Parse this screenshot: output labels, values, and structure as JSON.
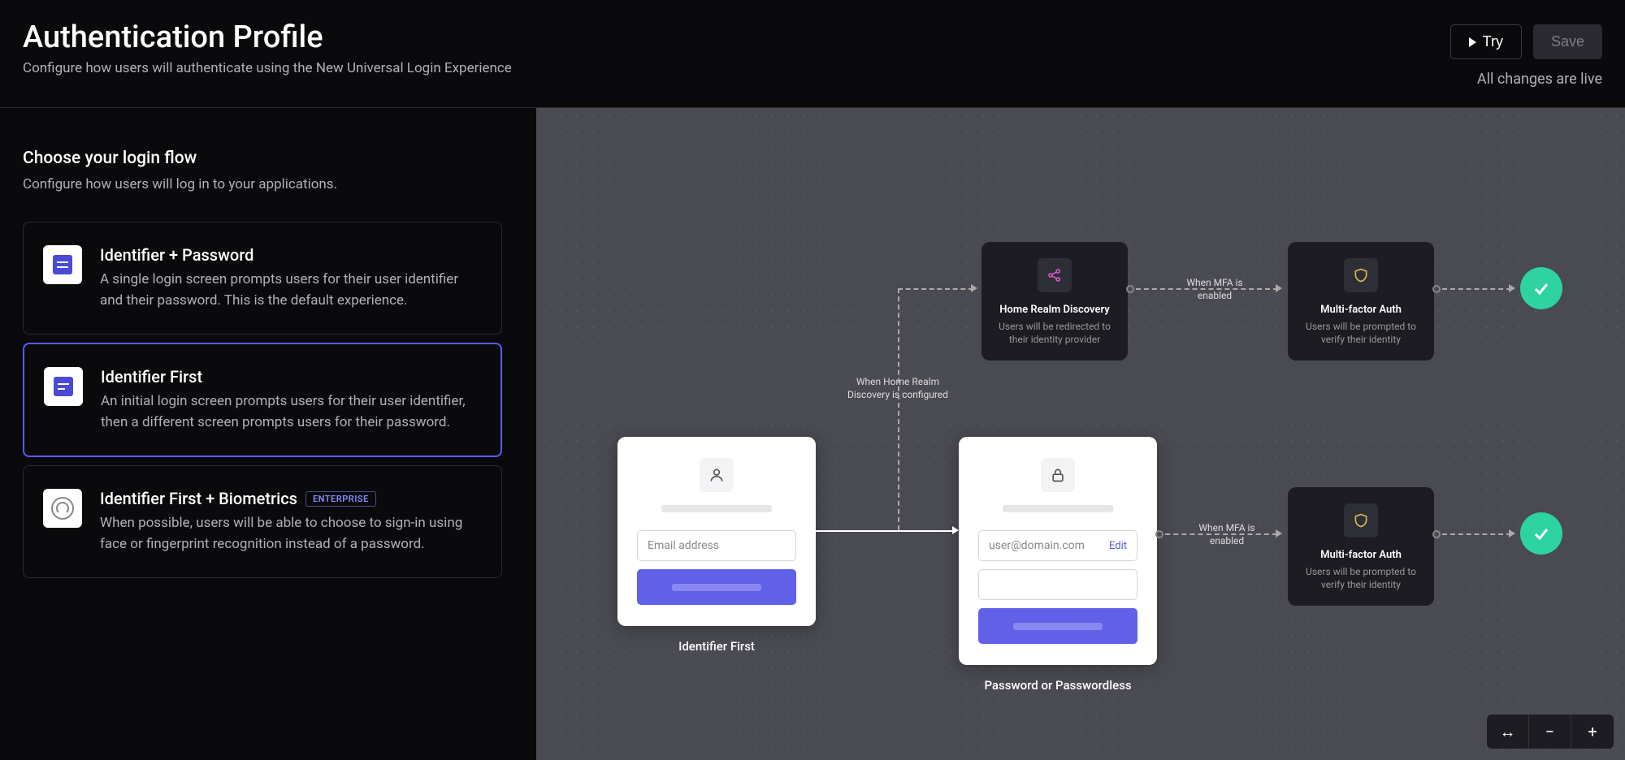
{
  "header": {
    "title": "Authentication Profile",
    "subtitle": "Configure how users will authenticate using the New Universal Login Experience",
    "try_label": "Try",
    "save_label": "Save",
    "status": "All changes are live"
  },
  "sidebar": {
    "heading": "Choose your login flow",
    "subheading": "Configure how users will log in to your applications.",
    "options": [
      {
        "title": "Identifier + Password",
        "desc": "A single login screen prompts users for their user identifier and their password. This is the default experience."
      },
      {
        "title": "Identifier First",
        "desc": "An initial login screen prompts users for their user identifier, then a different screen prompts users for their password."
      },
      {
        "title": "Identifier First + Biometrics",
        "desc": "When possible, users will be able to choose to sign-in using face or fingerprint recognition instead of a password.",
        "badge": "ENTERPRISE"
      }
    ]
  },
  "canvas": {
    "card1": {
      "placeholder": "Email address",
      "label": "Identifier First"
    },
    "card2": {
      "value": "user@domain.com",
      "edit": "Edit",
      "label": "Password or Passwordless"
    },
    "node_hrd": {
      "title": "Home Realm Discovery",
      "desc": "Users will be redirected to their identity provider"
    },
    "node_mfa": {
      "title": "Multi-factor Auth",
      "desc": "Users will be prompted to verify their identity"
    },
    "edge_hrd": "When Home Realm Discovery is configured",
    "edge_mfa": "When MFA is enabled"
  }
}
